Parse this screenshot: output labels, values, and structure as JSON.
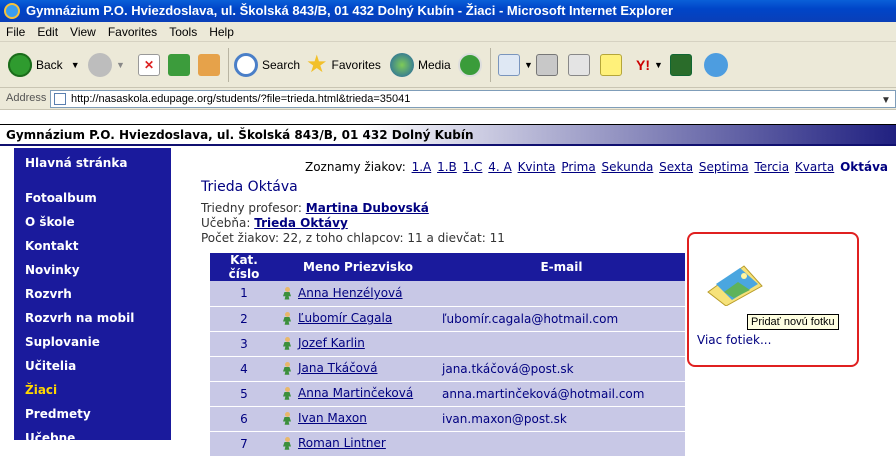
{
  "window": {
    "title": "Gymnázium P.O. Hviezdoslava, ul. Školská 843/B, 01 432 Dolný Kubín - Žiaci - Microsoft Internet Explorer"
  },
  "menu": [
    "File",
    "Edit",
    "View",
    "Favorites",
    "Tools",
    "Help"
  ],
  "toolbar": {
    "back": "Back",
    "search": "Search",
    "favorites": "Favorites",
    "media": "Media"
  },
  "address": {
    "label": "Address",
    "url": "http://nasaskola.edupage.org/students/?file=trieda.html&trieda=35041"
  },
  "site": {
    "header": "Gymnázium P.O. Hviezdoslava, ul. Školská 843/B, 01 432 Dolný Kubín"
  },
  "sidebar": {
    "items": [
      {
        "label": "Hlavná stránka",
        "active": false
      },
      {
        "label": "Fotoalbum",
        "active": false
      },
      {
        "label": "O škole",
        "active": false
      },
      {
        "label": "Kontakt",
        "active": false
      },
      {
        "label": "Novinky",
        "active": false
      },
      {
        "label": "Rozvrh",
        "active": false
      },
      {
        "label": "Rozvrh na mobil",
        "active": false
      },
      {
        "label": "Suplovanie",
        "active": false
      },
      {
        "label": "Učitelia",
        "active": false
      },
      {
        "label": "Žiaci",
        "active": true
      },
      {
        "label": "Predmety",
        "active": false
      },
      {
        "label": "Učebne",
        "active": false
      }
    ]
  },
  "classes": {
    "label": "Zoznamy žiakov:",
    "items": [
      "1.A",
      "1.B",
      "1.C",
      "4. A",
      "Kvinta",
      "Prima",
      "Sekunda",
      "Sexta",
      "Septima",
      "Tercia",
      "Kvarta",
      "Oktáva"
    ],
    "current": "Oktáva"
  },
  "main": {
    "title": "Trieda Oktáva",
    "teacher_label": "Triedny profesor:",
    "teacher": "Martina Dubovská",
    "room_label": "Učebňa:",
    "room": "Trieda Oktávy",
    "count": "Počet žiakov: 22, z toho chlapcov: 11 a dievčat: 11"
  },
  "table": {
    "headers": [
      "Kat. číslo",
      "Meno Priezvisko",
      "E-mail"
    ],
    "rows": [
      {
        "num": "1",
        "name": "Anna Henzélyová",
        "email": ""
      },
      {
        "num": "2",
        "name": "Ľubomír Cagala",
        "email": "ľubomír.cagala@hotmail.com"
      },
      {
        "num": "3",
        "name": "Jozef Karlin",
        "email": ""
      },
      {
        "num": "4",
        "name": "Jana Tkáčová",
        "email": "jana.tkáčová@post.sk"
      },
      {
        "num": "5",
        "name": "Anna Martinčeková",
        "email": "anna.martinčeková@hotmail.com"
      },
      {
        "num": "6",
        "name": "Ivan Maxon",
        "email": "ivan.maxon@post.sk"
      },
      {
        "num": "7",
        "name": "Roman Lintner",
        "email": ""
      }
    ]
  },
  "photos": {
    "tooltip": "Pridať novú fotku",
    "more": "Viac fotiek..."
  }
}
